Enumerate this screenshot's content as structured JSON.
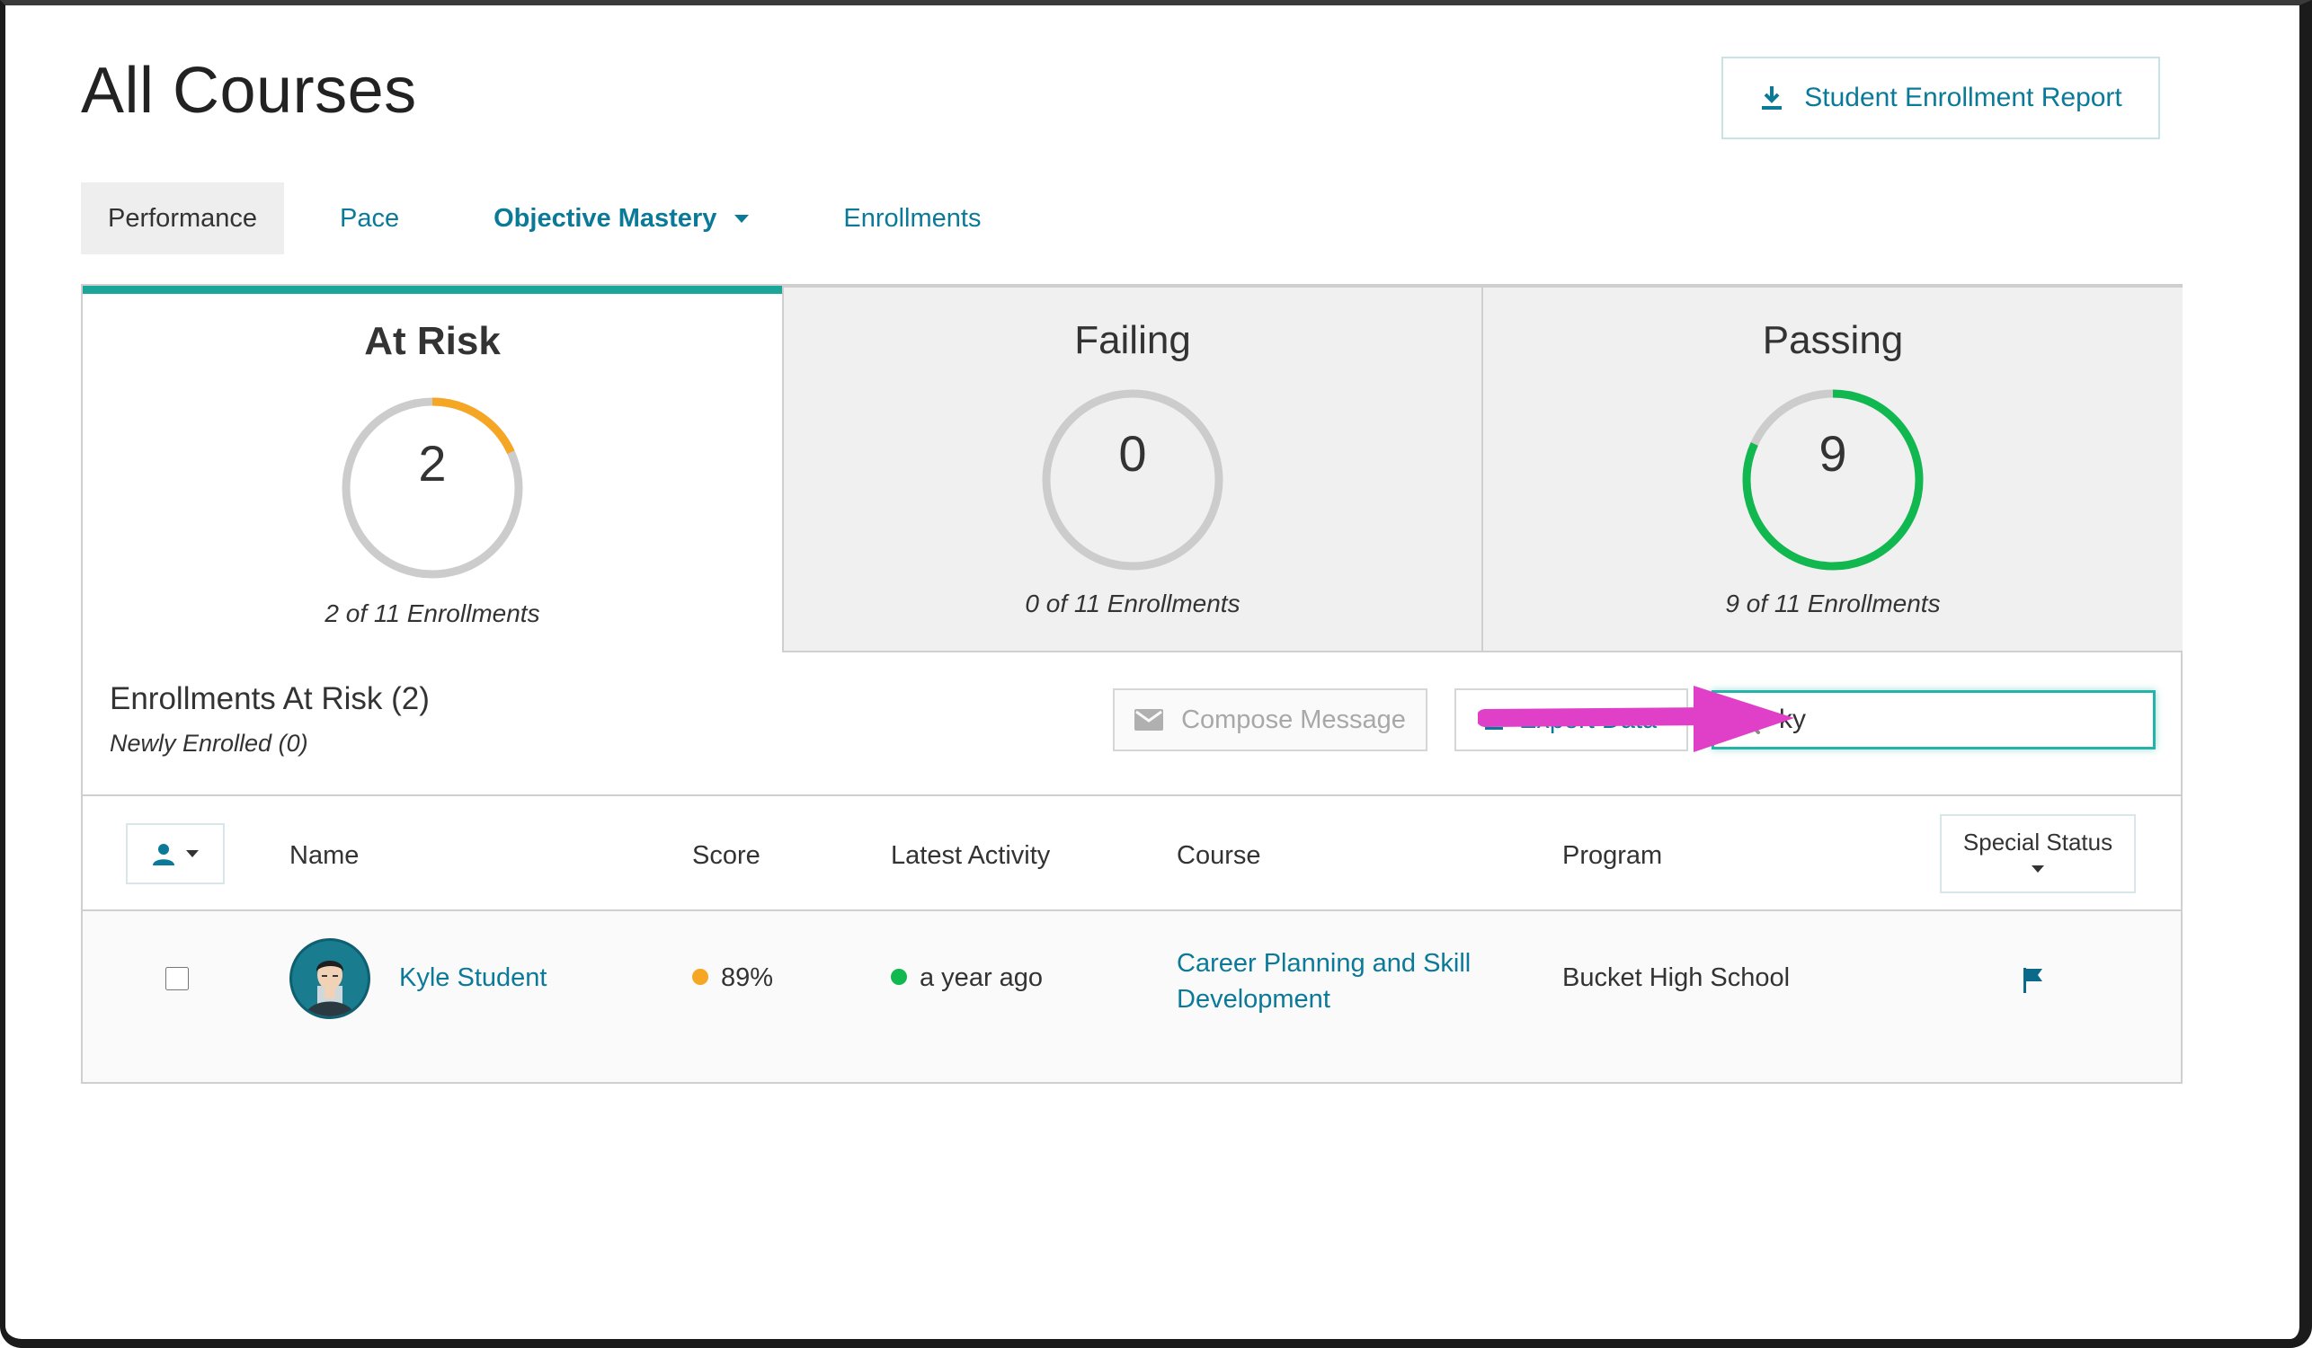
{
  "page": {
    "title": "All Courses",
    "report_button": "Student Enrollment Report"
  },
  "tabs": [
    {
      "label": "Performance",
      "active": true
    },
    {
      "label": "Pace"
    },
    {
      "label": "Objective Mastery"
    },
    {
      "label": "Enrollments"
    }
  ],
  "stats": [
    {
      "title": "At Risk",
      "value": "2",
      "subtitle": "2 of 11 Enrollments",
      "fraction": 0.182,
      "color": "#f5a623"
    },
    {
      "title": "Failing",
      "value": "0",
      "subtitle": "0 of 11 Enrollments",
      "fraction": 0,
      "color": "#e04b3a"
    },
    {
      "title": "Passing",
      "value": "9",
      "subtitle": "9 of 11 Enrollments",
      "fraction": 0.818,
      "color": "#10b84f"
    }
  ],
  "section": {
    "title": "Enrollments At Risk (2)",
    "subtitle": "Newly Enrolled (0)",
    "compose_label": "Compose Message",
    "export_label": "Export Data",
    "search_value": "ky"
  },
  "table": {
    "headers": [
      "Name",
      "Score",
      "Latest Activity",
      "Course",
      "Program"
    ],
    "special_status": "Special Status",
    "rows": [
      {
        "name": "Kyle Student",
        "score": "89%",
        "score_color": "#f5a623",
        "activity": "a year ago",
        "activity_color": "#10b84f",
        "course_line1": "Career Planning and Skill",
        "course_line2": "Development",
        "program": "Bucket High School"
      }
    ]
  },
  "colors": {
    "accent": "#0b7a99",
    "teal_active": "#1aa79a",
    "annotation_arrow": "#e040c8"
  }
}
